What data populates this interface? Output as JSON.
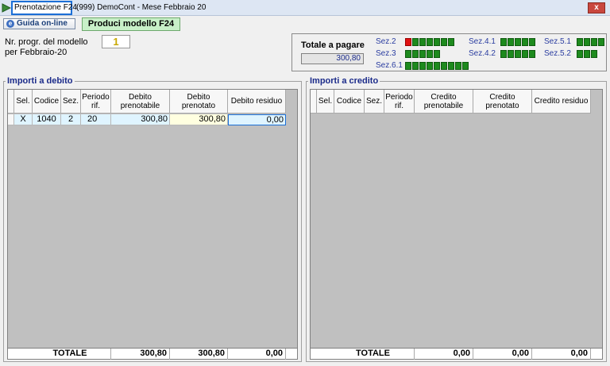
{
  "window": {
    "tab_label": "Prenotazione F24",
    "title": "(999) DemoCont  - Mese Febbraio 20",
    "close_label": "x"
  },
  "toolbar": {
    "help_label": "Guida on-line",
    "produci_label": "Produci modello F24"
  },
  "progressive": {
    "label": "Nr. progr. del modello per Febbraio-20",
    "value": "1"
  },
  "summary": {
    "total_label": "Totale a pagare",
    "total_value": "300,80",
    "sections": [
      {
        "label": "Sez.2",
        "segments": 7,
        "first_red": true
      },
      {
        "label": "Sez.3",
        "segments": 5,
        "first_red": false
      },
      {
        "label": "Sez.6.1",
        "segments": 9,
        "first_red": false
      },
      {
        "label": "Sez.4.1",
        "segments": 5,
        "first_red": false
      },
      {
        "label": "Sez.4.2",
        "segments": 5,
        "first_red": false
      },
      {
        "label": "Sez.5.1",
        "segments": 4,
        "first_red": false
      },
      {
        "label": "Sez.5.2",
        "segments": 3,
        "first_red": false
      }
    ]
  },
  "debito": {
    "title": "Importi a debito",
    "columns": [
      "Sel.",
      "Codice",
      "Sez.",
      "Periodo rif.",
      "Debito prenotabile",
      "Debito prenotato",
      "Debito residuo"
    ],
    "rows": [
      [
        "X",
        "1040",
        "2",
        "20",
        "300,80",
        "300,80",
        "0,00"
      ]
    ],
    "totals": {
      "label": "TOTALE",
      "prenotabile": "300,80",
      "prenotato": "300,80",
      "residuo": "0,00"
    }
  },
  "credito": {
    "title": "Importi a credito",
    "columns": [
      "Sel.",
      "Codice",
      "Sez.",
      "Periodo rif.",
      "Credito prenotabile",
      "Credito prenotato",
      "Credito residuo"
    ],
    "rows": [],
    "totals": {
      "label": "TOTALE",
      "prenotabile": "0,00",
      "prenotato": "0,00",
      "residuo": "0,00"
    }
  }
}
